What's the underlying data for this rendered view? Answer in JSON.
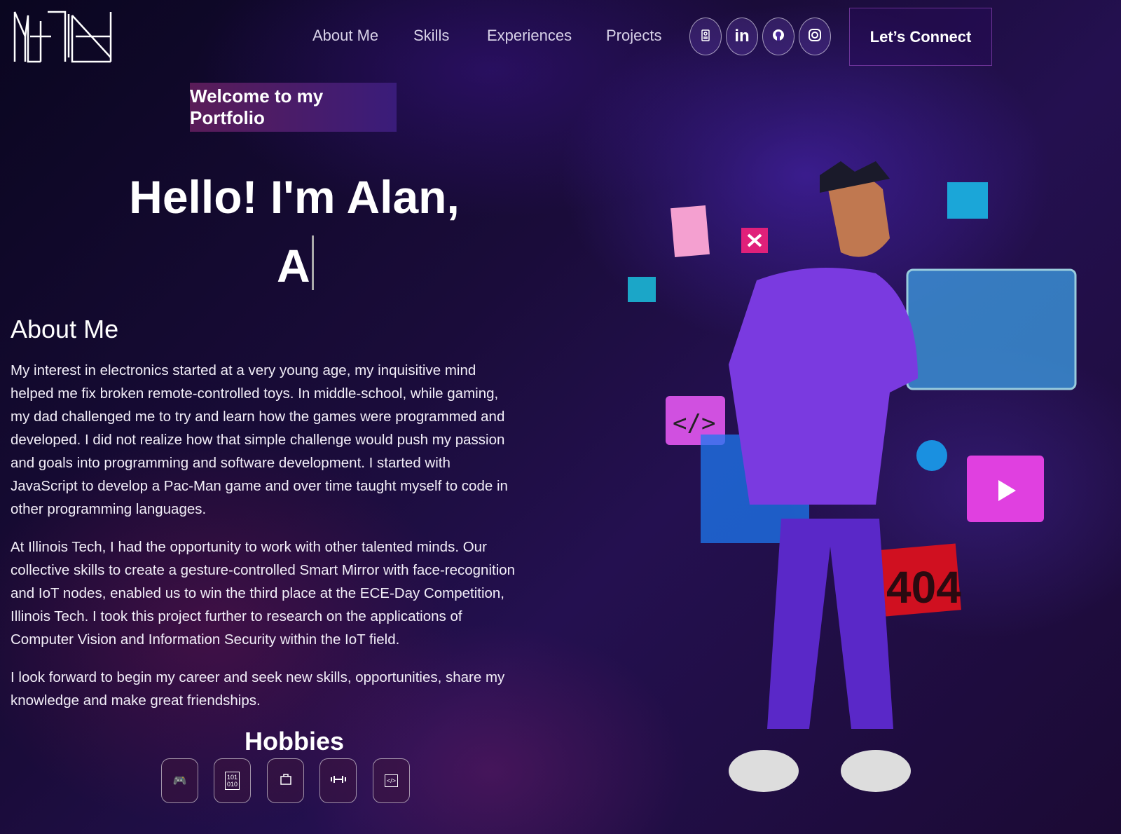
{
  "nav": {
    "logo_text": "ALAN",
    "links": [
      "About Me",
      "Skills",
      "Experiences",
      "Projects"
    ],
    "social": [
      "resume-icon",
      "linkedin-icon",
      "github-icon",
      "instagram-icon"
    ],
    "connect": "Let’s Connect"
  },
  "hero": {
    "welcome": "Welcome to my Portfolio",
    "hello": "Hello! I'm Alan,",
    "typed": "A"
  },
  "about": {
    "title": "About Me",
    "paragraphs": [
      "My interest in electronics started at a very young age, my inquisitive mind helped me fix broken remote-controlled toys. In middle-school, while gaming, my dad challenged me to try and learn how the games were programmed and developed. I did not realize how that simple challenge would push my passion and goals into programming and software development. I started with JavaScript to develop a Pac-Man game and over time taught myself to code in other programming languages.",
      "At Illinois Tech, I had the opportunity to work with other talented minds. Our collective skills to create a gesture-controlled Smart Mirror with face-recognition and IoT nodes, enabled us to win the third place at the ECE-Day Competition, Illinois Tech. I took this project further to research on the applications of Computer Vision and Information Security within the IoT field.",
      "I look forward to begin my career and seek new skills, opportunities, share my knowledge and make great friendships."
    ]
  },
  "hobbies": {
    "title": "Hobbies",
    "icons": [
      "gamepad-icon",
      "binary-book-icon",
      "suitcase-icon",
      "dumbbell-icon",
      "code-window-icon"
    ]
  },
  "illustration": {
    "error_label": "404"
  }
}
